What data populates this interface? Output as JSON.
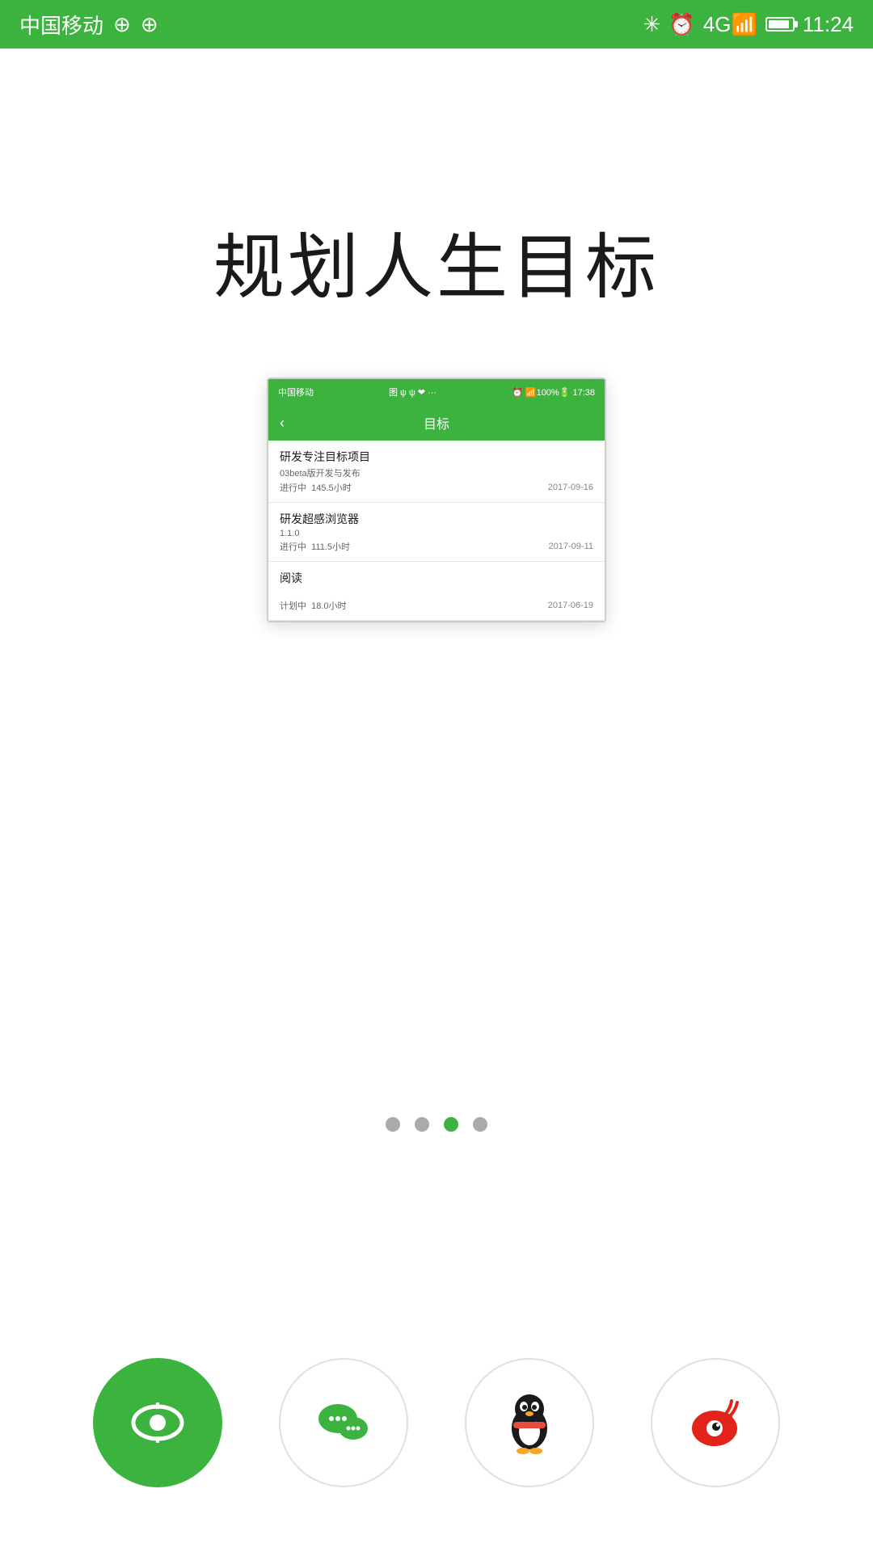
{
  "statusBar": {
    "carrier": "中国移动",
    "time": "11:24",
    "icons": [
      "bluetooth",
      "alarm",
      "4g",
      "signal",
      "battery"
    ]
  },
  "mainTitle": "规划人生目标",
  "mockApp": {
    "statusBar": {
      "left": "中国移动",
      "icons": "图 ψ ψ ❤ ...",
      "right": "⏰ 📶100% 🔋 17:38"
    },
    "header": {
      "back": "‹",
      "title": "目标"
    },
    "items": [
      {
        "title": "研发专注目标项目",
        "subtitle": "03beta版开发与发布",
        "status": "进行中",
        "hours": "145.5小时",
        "date": "2017-09-16"
      },
      {
        "title": "研发超感浏览器",
        "subtitle": "1.1.0",
        "status": "进行中",
        "hours": "111.5小时",
        "date": "2017-09-11"
      },
      {
        "title": "阅读",
        "subtitle": "",
        "status": "计划中",
        "hours": "18.0小时",
        "date": "2017-06-19"
      }
    ]
  },
  "pagination": {
    "total": 4,
    "active": 2
  },
  "bottomIcons": [
    {
      "id": "main-app",
      "type": "active",
      "label": "主应用"
    },
    {
      "id": "wechat",
      "type": "outline",
      "label": "微信"
    },
    {
      "id": "qq",
      "type": "outline",
      "label": "QQ"
    },
    {
      "id": "weibo",
      "type": "outline",
      "label": "微博"
    }
  ]
}
